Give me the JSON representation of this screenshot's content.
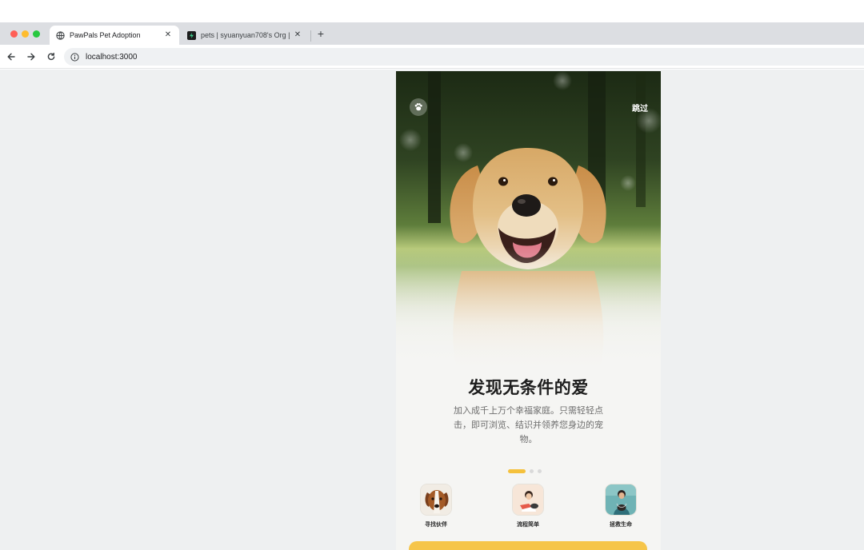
{
  "browser": {
    "tabs": [
      {
        "title": "PawPals Pet Adoption",
        "active": true,
        "icon": "globe-icon"
      },
      {
        "title": "pets | syuanyuan708's Org | S",
        "active": false,
        "icon": "database-icon"
      }
    ],
    "url": "localhost:3000"
  },
  "onboarding": {
    "skip_label": "跳过",
    "headline": "发现无条件的爱",
    "description": "加入成千上万个幸福家庭。只需轻轻点击，即可浏览、结识并领养您身边的宠物。",
    "page_index": 1,
    "page_count": 3,
    "accent_color": "#f6c54a",
    "features": [
      {
        "label": "寻找伙伴",
        "icon": "puppy-photo"
      },
      {
        "label": "流程简单",
        "icon": "person-with-pet-photo"
      },
      {
        "label": "拯救生命",
        "icon": "vet-photo"
      }
    ]
  }
}
